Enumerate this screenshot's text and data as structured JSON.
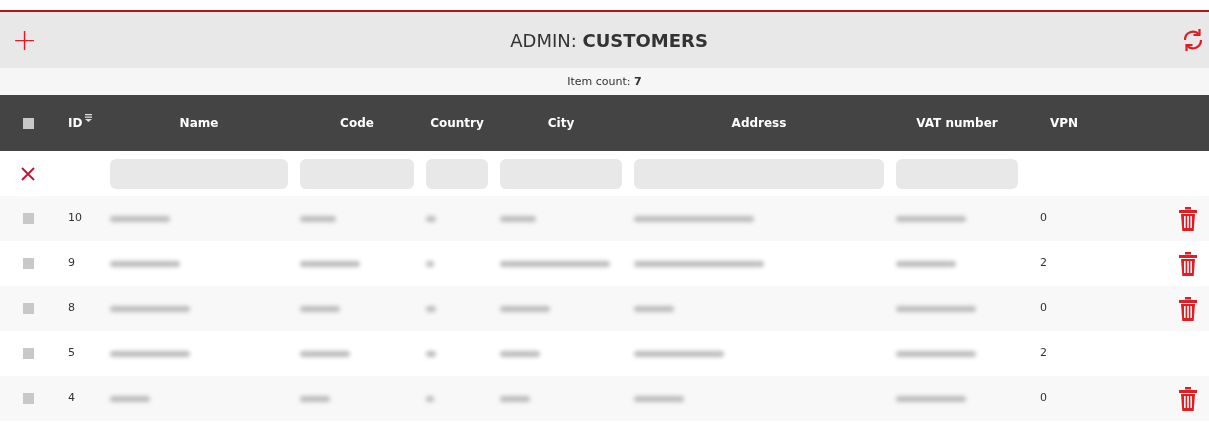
{
  "header": {
    "add_icon": "+",
    "title_prefix": "ADMIN: ",
    "title": "CUSTOMERS"
  },
  "item_count": {
    "label": "Item count: ",
    "value": "7"
  },
  "table": {
    "select_all": {
      "checked": false
    },
    "columns": [
      {
        "label": "ID",
        "sorted": true,
        "filter": false
      },
      {
        "label": "Name",
        "sorted": false,
        "filter": true
      },
      {
        "label": "Code",
        "sorted": false,
        "filter": true
      },
      {
        "label": "Country",
        "sorted": false,
        "filter": true
      },
      {
        "label": "City",
        "sorted": false,
        "filter": true
      },
      {
        "label": "Address",
        "sorted": false,
        "filter": true
      },
      {
        "label": "VAT number",
        "sorted": false,
        "filter": true
      },
      {
        "label": "VPN",
        "sorted": false,
        "filter": false
      }
    ],
    "rows": [
      {
        "id": "10",
        "vpn": "0",
        "checked": false,
        "deletable": true
      },
      {
        "id": "9",
        "vpn": "2",
        "checked": false,
        "deletable": true
      },
      {
        "id": "8",
        "vpn": "0",
        "checked": false,
        "deletable": true
      },
      {
        "id": "5",
        "vpn": "2",
        "checked": false,
        "deletable": false
      },
      {
        "id": "4",
        "vpn": "0",
        "checked": false,
        "deletable": true
      }
    ]
  }
}
